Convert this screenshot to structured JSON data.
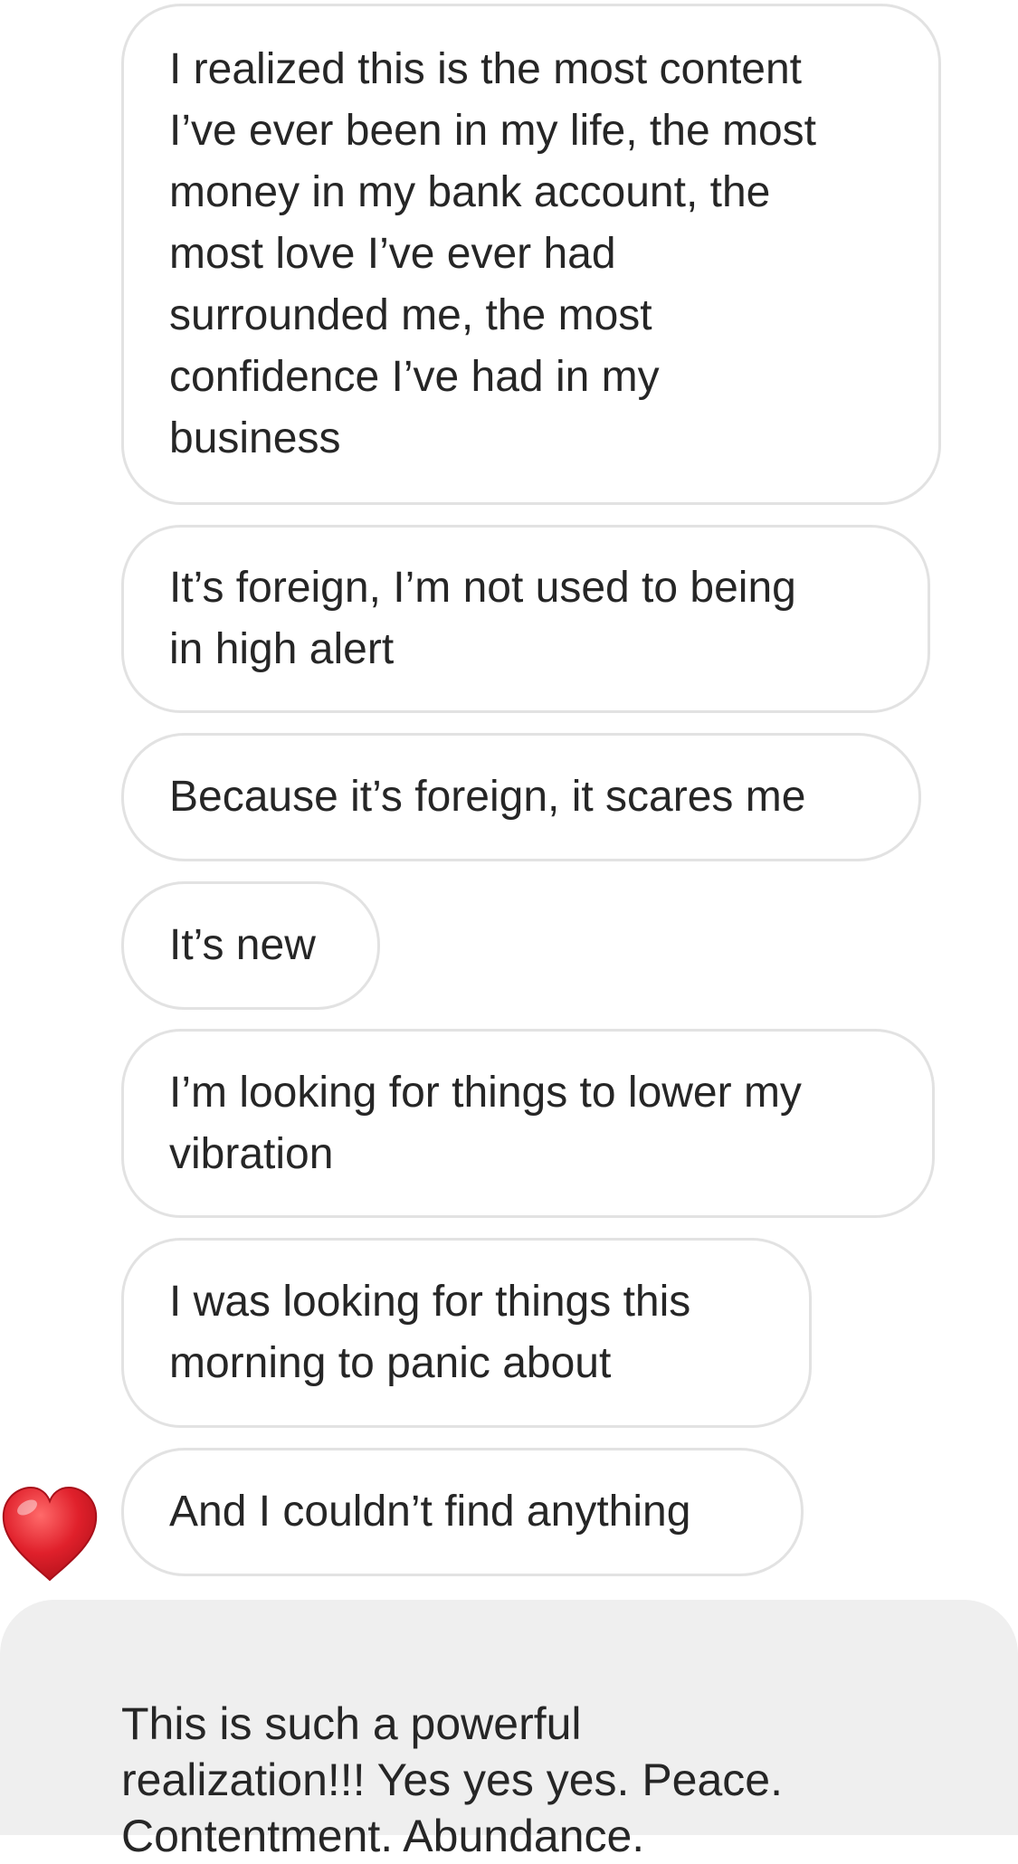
{
  "thread": {
    "outgoing": [
      "I realized this is the most content\nI’ve ever been in my life, the most\nmoney in my bank account, the\nmost love I’ve ever had\nsurrounded me, the most\nconfidence I’ve had in my\nbusiness",
      "It’s foreign, I’m not used to being\nin high alert",
      "Because it’s foreign, it scares me",
      "It’s new",
      "I’m looking for things to lower my\nvibration",
      "I was looking for things this\nmorning to panic about",
      "And I couldn’t find anything"
    ],
    "reaction": {
      "icon": "red-heart-icon",
      "color": "#e0202b"
    },
    "incoming": "This is such a powerful\nrealization!!! Yes yes yes. Peace.\nContentment. Abundance."
  }
}
